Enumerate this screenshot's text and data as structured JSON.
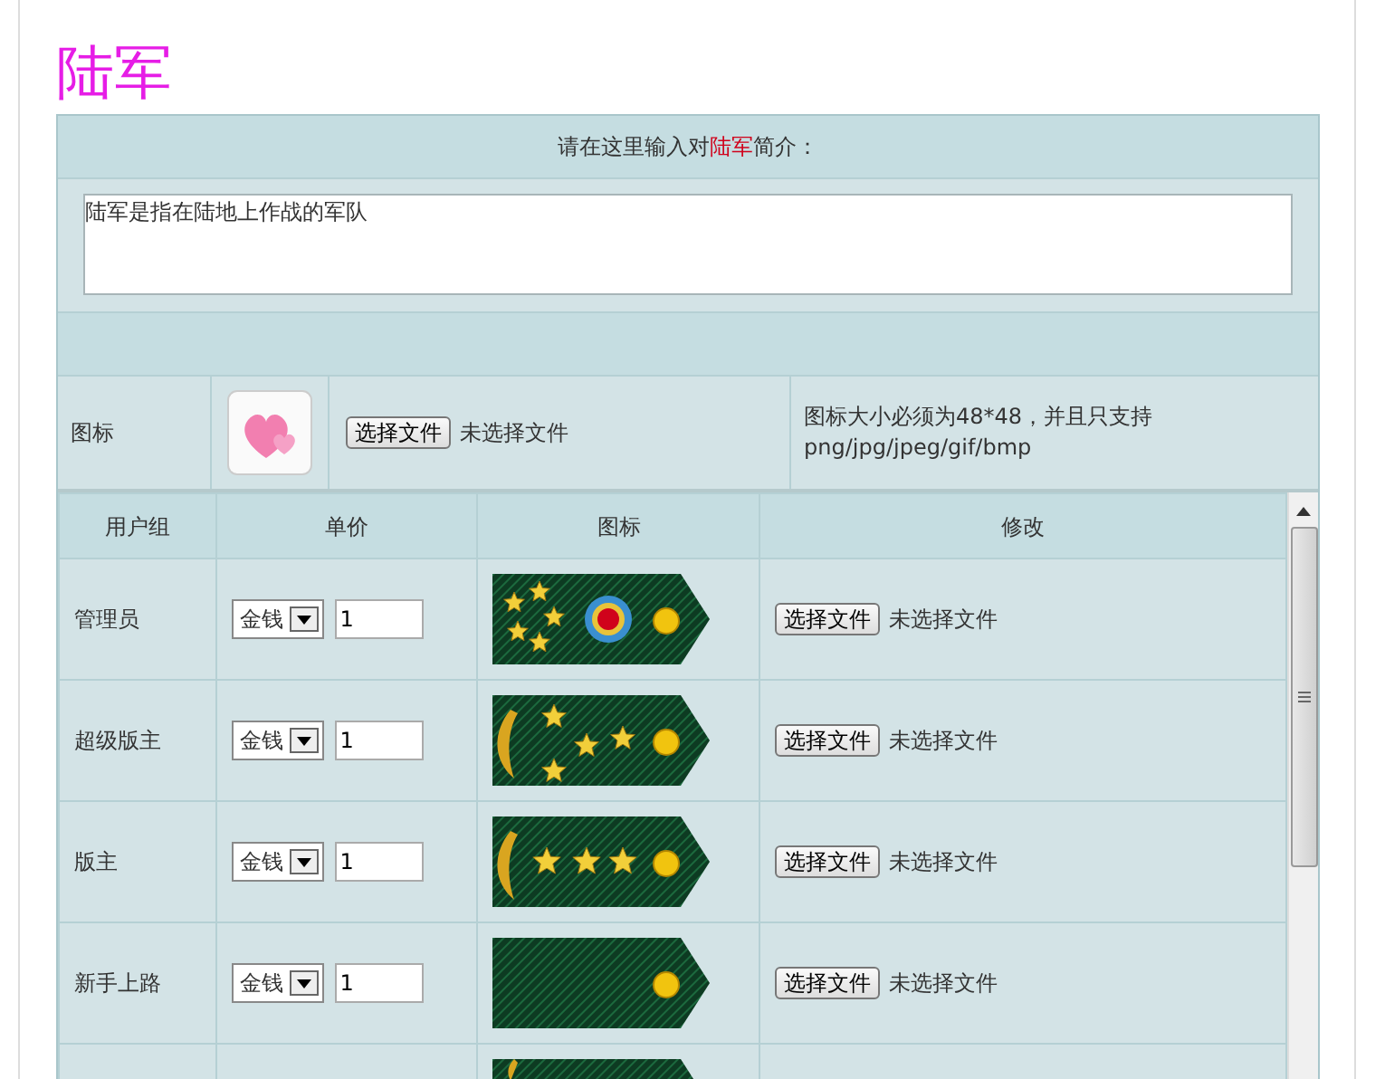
{
  "title": "陆军",
  "intro": {
    "prompt_before": "请在这里输入对",
    "prompt_highlight": "陆军",
    "prompt_after": "简介：",
    "value": "陆军是指在陆地上作战的军队"
  },
  "icon_row": {
    "label": "图标",
    "file_button": "选择文件",
    "file_status": "未选择文件",
    "hint": "图标大小必须为48*48，并且只支持png/jpg/jpeg/gif/bmp"
  },
  "table": {
    "columns": [
      "用户组",
      "单价",
      "图标",
      "修改"
    ],
    "rows": [
      {
        "group": "管理员",
        "currency": "金钱",
        "price": "1",
        "file_button": "选择文件",
        "file_status": "未选择文件"
      },
      {
        "group": "超级版主",
        "currency": "金钱",
        "price": "1",
        "file_button": "选择文件",
        "file_status": "未选择文件"
      },
      {
        "group": "版主",
        "currency": "金钱",
        "price": "1",
        "file_button": "选择文件",
        "file_status": "未选择文件"
      },
      {
        "group": "新手上路",
        "currency": "金钱",
        "price": "1",
        "file_button": "选择文件",
        "file_status": "未选择文件"
      },
      {
        "kind": "cut"
      }
    ]
  }
}
